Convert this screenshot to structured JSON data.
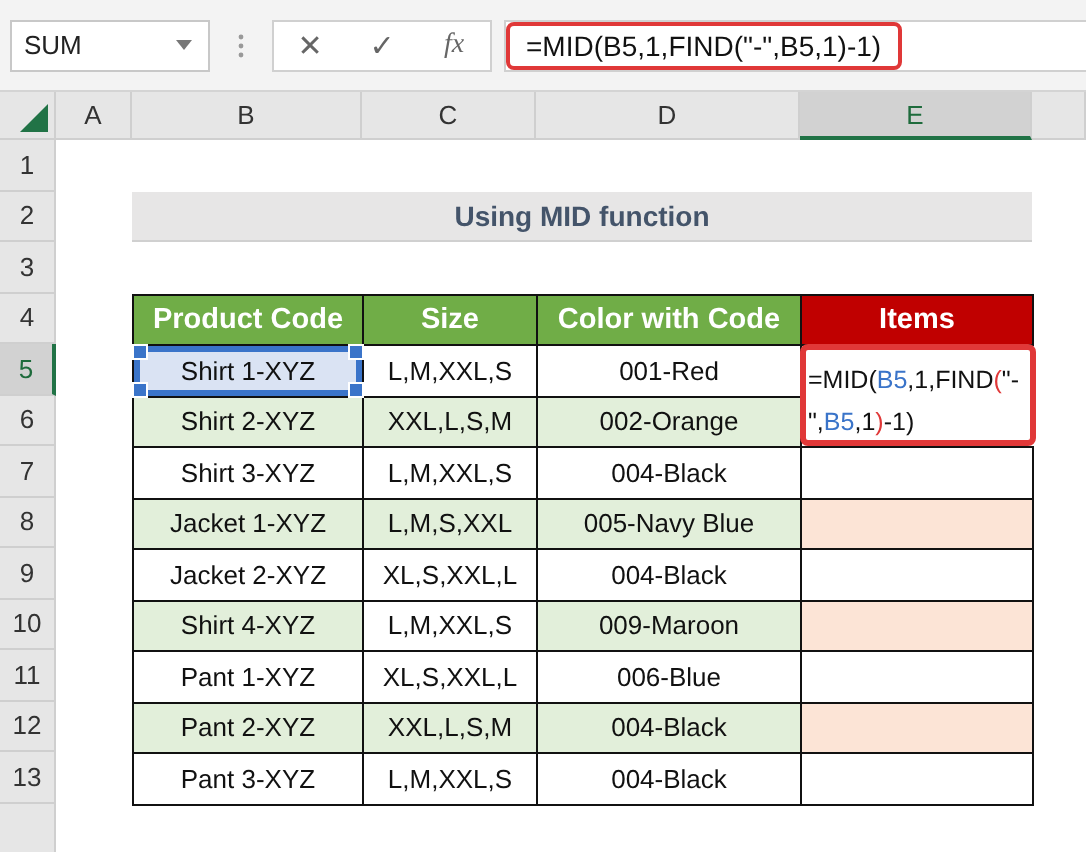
{
  "name_box": {
    "value": "SUM"
  },
  "formula_buttons": {
    "cancel": "✕",
    "enter": "✓",
    "function": "fx"
  },
  "formula_bar": {
    "value": "=MID(B5,1,FIND(\"-\",B5,1)-1)",
    "highlighted": true
  },
  "columns": [
    {
      "label": "A",
      "selected": false
    },
    {
      "label": "B",
      "selected": false
    },
    {
      "label": "C",
      "selected": false
    },
    {
      "label": "D",
      "selected": false
    },
    {
      "label": "E",
      "selected": true
    }
  ],
  "row_headers": [
    {
      "label": "1",
      "selected": false
    },
    {
      "label": "2",
      "selected": false
    },
    {
      "label": "3",
      "selected": false
    },
    {
      "label": "4",
      "selected": false
    },
    {
      "label": "5",
      "selected": true
    },
    {
      "label": "6",
      "selected": false
    },
    {
      "label": "7",
      "selected": false
    },
    {
      "label": "8",
      "selected": false
    },
    {
      "label": "9",
      "selected": false
    },
    {
      "label": "10",
      "selected": false
    },
    {
      "label": "11",
      "selected": false
    },
    {
      "label": "12",
      "selected": false
    },
    {
      "label": "13",
      "selected": false
    }
  ],
  "title": "Using MID function",
  "table": {
    "columns": [
      {
        "label": "Product Code",
        "kind": "green"
      },
      {
        "label": "Size",
        "kind": "green"
      },
      {
        "label": "Color with Code",
        "kind": "green"
      },
      {
        "label": "Items",
        "kind": "red"
      }
    ],
    "rows": [
      {
        "cells": [
          {
            "kind": "text",
            "text": "Shirt 1-XYZ",
            "color": "#dae3f3",
            "selected": true
          },
          {
            "kind": "text",
            "text": "L,M,XXL,S",
            "color": "#ffffff",
            "selected": false
          },
          {
            "kind": "text",
            "text": "001-Red",
            "color": "#ffffff",
            "selected": false
          },
          {
            "kind": "editor",
            "segments": [
              {
                "kind": "plain",
                "text": "=MID("
              },
              {
                "kind": "ref",
                "text": "B5"
              },
              {
                "kind": "plain",
                "text": ",1,FIND"
              },
              {
                "kind": "paren",
                "text": "("
              },
              {
                "kind": "plain",
                "text": "\"-\","
              },
              {
                "kind": "ref",
                "text": "B5"
              },
              {
                "kind": "plain",
                "text": ",1"
              },
              {
                "kind": "paren",
                "text": ")"
              },
              {
                "kind": "plain",
                "text": "-1)"
              }
            ]
          }
        ]
      },
      {
        "cells": [
          {
            "kind": "text",
            "text": "Shirt 2-XYZ",
            "color": "#e2efda",
            "selected": false
          },
          {
            "kind": "text",
            "text": "XXL,L,S,M",
            "color": "#e2efda",
            "selected": false
          },
          {
            "kind": "text",
            "text": "002-Orange",
            "color": "#e2efda",
            "selected": false
          }
        ]
      },
      {
        "cells": [
          {
            "kind": "text",
            "text": "Shirt 3-XYZ",
            "color": "#ffffff",
            "selected": false
          },
          {
            "kind": "text",
            "text": "L,M,XXL,S",
            "color": "#ffffff",
            "selected": false
          },
          {
            "kind": "text",
            "text": "004-Black",
            "color": "#ffffff",
            "selected": false
          },
          {
            "kind": "text",
            "text": "",
            "color": "#ffffff",
            "selected": false
          }
        ]
      },
      {
        "cells": [
          {
            "kind": "text",
            "text": "Jacket 1-XYZ",
            "color": "#e2efda",
            "selected": false
          },
          {
            "kind": "text",
            "text": "L,M,S,XXL",
            "color": "#e2efda",
            "selected": false
          },
          {
            "kind": "text",
            "text": "005-Navy Blue",
            "color": "#e2efda",
            "selected": false
          },
          {
            "kind": "text",
            "text": "",
            "color": "#fce4d6",
            "selected": false
          }
        ]
      },
      {
        "cells": [
          {
            "kind": "text",
            "text": "Jacket 2-XYZ",
            "color": "#ffffff",
            "selected": false
          },
          {
            "kind": "text",
            "text": "XL,S,XXL,L",
            "color": "#ffffff",
            "selected": false
          },
          {
            "kind": "text",
            "text": "004-Black",
            "color": "#ffffff",
            "selected": false
          },
          {
            "kind": "text",
            "text": "",
            "color": "#ffffff",
            "selected": false
          }
        ]
      },
      {
        "cells": [
          {
            "kind": "text",
            "text": "Shirt 4-XYZ",
            "color": "#e2efda",
            "selected": false
          },
          {
            "kind": "text",
            "text": "L,M,XXL,S",
            "color": "#ffffff",
            "selected": false
          },
          {
            "kind": "text",
            "text": "009-Maroon",
            "color": "#e2efda",
            "selected": false
          },
          {
            "kind": "text",
            "text": "",
            "color": "#fce4d6",
            "selected": false
          }
        ]
      },
      {
        "cells": [
          {
            "kind": "text",
            "text": "Pant 1-XYZ",
            "color": "#ffffff",
            "selected": false
          },
          {
            "kind": "text",
            "text": "XL,S,XXL,L",
            "color": "#ffffff",
            "selected": false
          },
          {
            "kind": "text",
            "text": "006-Blue",
            "color": "#ffffff",
            "selected": false
          },
          {
            "kind": "text",
            "text": "",
            "color": "#ffffff",
            "selected": false
          }
        ]
      },
      {
        "cells": [
          {
            "kind": "text",
            "text": "Pant 2-XYZ",
            "color": "#e2efda",
            "selected": false
          },
          {
            "kind": "text",
            "text": "XXL,L,S,M",
            "color": "#e2efda",
            "selected": false
          },
          {
            "kind": "text",
            "text": "004-Black",
            "color": "#e2efda",
            "selected": false
          },
          {
            "kind": "text",
            "text": "",
            "color": "#fce4d6",
            "selected": false
          }
        ]
      },
      {
        "cells": [
          {
            "kind": "text",
            "text": "Pant 3-XYZ",
            "color": "#ffffff",
            "selected": false
          },
          {
            "kind": "text",
            "text": "L,M,XXL,S",
            "color": "#ffffff",
            "selected": false
          },
          {
            "kind": "text",
            "text": "004-Black",
            "color": "#ffffff",
            "selected": false
          },
          {
            "kind": "text",
            "text": "",
            "color": "#ffffff",
            "selected": false
          }
        ]
      }
    ]
  }
}
